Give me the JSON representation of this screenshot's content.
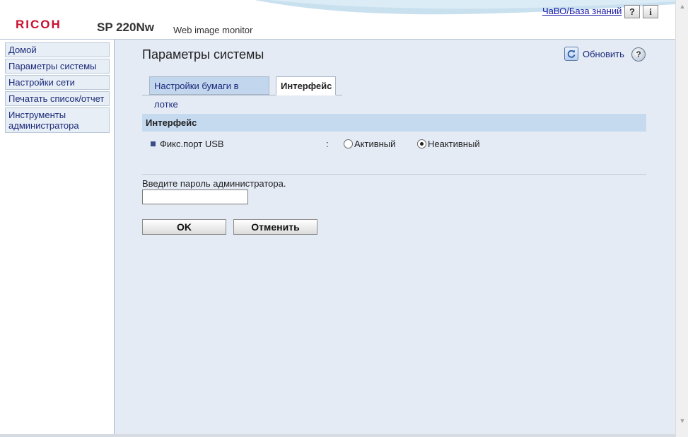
{
  "header": {
    "logo": "RICOH",
    "model": "SP 220Nw",
    "product": "Web image monitor",
    "faq_link": "ЧаВО/База знаний",
    "help_button": "?",
    "info_button": "i"
  },
  "sidebar": {
    "items": [
      {
        "label": "Домой"
      },
      {
        "label": "Параметры системы"
      },
      {
        "label": "Настройки сети"
      },
      {
        "label": "Печатать список/отчет"
      },
      {
        "label_line1": "Инструменты",
        "label_line2": "администратора"
      }
    ]
  },
  "main": {
    "title": "Параметры системы",
    "refresh_label": "Обновить",
    "help_symbol": "?",
    "tabs": [
      {
        "label": "Настройки бумаги в лотке",
        "active": false
      },
      {
        "label": "Интерфейс",
        "active": true
      }
    ],
    "section_header": "Интерфейс",
    "setting": {
      "label": "Фикс.порт USB",
      "colon": ":",
      "options": [
        {
          "label": "Активный",
          "checked": false
        },
        {
          "label": "Неактивный",
          "checked": true
        }
      ]
    },
    "password_prompt": "Введите пароль администратора.",
    "password_value": "",
    "ok_label": "OK",
    "cancel_label": "Отменить"
  },
  "colors": {
    "brand": "#c8102e",
    "main_background": "#e4ebf5",
    "section_header": "#c5d9ef",
    "nav_text": "#1a2a7a"
  }
}
